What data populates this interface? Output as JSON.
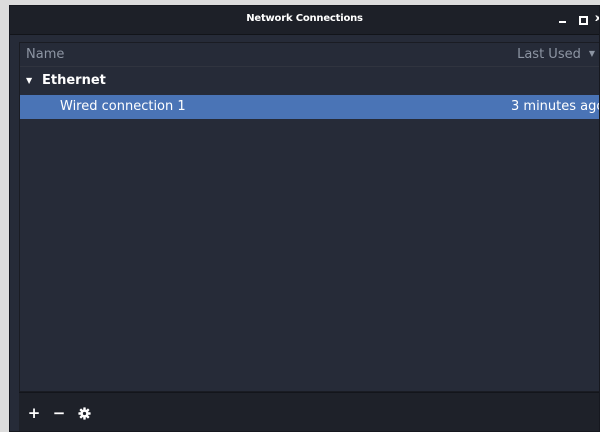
{
  "window": {
    "title": "Network Connections",
    "controls": {
      "close_glyph": "x"
    }
  },
  "list": {
    "columns": {
      "name": "Name",
      "last_used": "Last Used"
    },
    "group": {
      "label": "Ethernet",
      "expanded": true
    },
    "connections": [
      {
        "name": "Wired connection 1",
        "last_used": "3 minutes ago",
        "selected": true
      }
    ]
  },
  "toolbar": {
    "add_glyph": "+",
    "remove_glyph": "−",
    "icons": [
      "plus-icon",
      "minus-icon",
      "gear-icon"
    ]
  },
  "colors": {
    "window_bg": "#262b38",
    "titlebar_bg": "#1d2028",
    "selection": "#4a74b6",
    "header_text": "#8d95a3"
  }
}
